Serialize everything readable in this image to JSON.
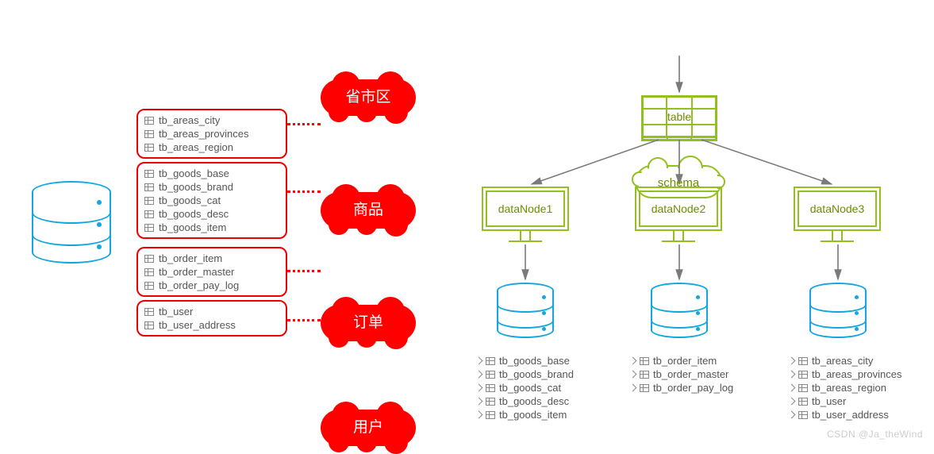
{
  "groups": {
    "areas": {
      "label": "省市区",
      "tables": [
        "tb_areas_city",
        "tb_areas_provinces",
        "tb_areas_region"
      ]
    },
    "goods": {
      "label": "商品",
      "tables": [
        "tb_goods_base",
        "tb_goods_brand",
        "tb_goods_cat",
        "tb_goods_desc",
        "tb_goods_item"
      ]
    },
    "order": {
      "label": "订单",
      "tables": [
        "tb_order_item",
        "tb_order_master",
        "tb_order_pay_log"
      ]
    },
    "user": {
      "label": "用户",
      "tables": [
        "tb_user",
        "tb_user_address"
      ]
    }
  },
  "schema": {
    "cloud_label": "schema",
    "table_label": "table"
  },
  "nodes": {
    "n1": {
      "label": "dataNode1",
      "tables": [
        "tb_goods_base",
        "tb_goods_brand",
        "tb_goods_cat",
        "tb_goods_desc",
        "tb_goods_item"
      ]
    },
    "n2": {
      "label": "dataNode2",
      "tables": [
        "tb_order_item",
        "tb_order_master",
        "tb_order_pay_log"
      ]
    },
    "n3": {
      "label": "dataNode3",
      "tables": [
        "tb_areas_city",
        "tb_areas_provinces",
        "tb_areas_region",
        "tb_user",
        "tb_user_address"
      ]
    }
  },
  "watermark": "CSDN @Ja_theWind"
}
